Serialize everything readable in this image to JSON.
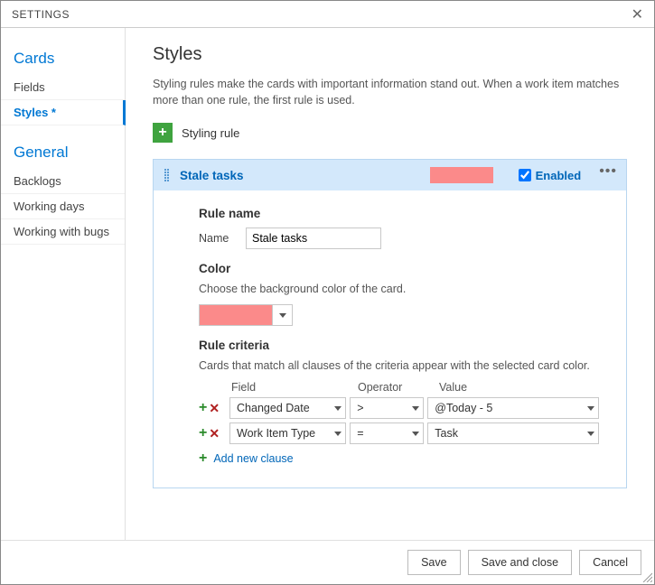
{
  "window": {
    "title": "SETTINGS"
  },
  "sidebar": {
    "sections": [
      {
        "title": "Cards",
        "items": [
          {
            "label": "Fields"
          },
          {
            "label": "Styles *",
            "selected": true
          }
        ]
      },
      {
        "title": "General",
        "items": [
          {
            "label": "Backlogs"
          },
          {
            "label": "Working days"
          },
          {
            "label": "Working with bugs"
          }
        ]
      }
    ]
  },
  "main": {
    "heading": "Styles",
    "description": "Styling rules make the cards with important information stand out. When a work item matches more than one rule, the first rule is used.",
    "add_rule_label": "Styling rule"
  },
  "rule": {
    "header_name": "Stale tasks",
    "enabled_label": "Enabled",
    "enabled": true,
    "swatch_color": "#fb8a8a",
    "sections": {
      "rule_name_title": "Rule name",
      "name_label": "Name",
      "name_value": "Stale tasks",
      "color_title": "Color",
      "color_desc": "Choose the background color of the card.",
      "criteria_title": "Rule criteria",
      "criteria_desc": "Cards that match all clauses of the criteria appear with the selected card color.",
      "col_field": "Field",
      "col_operator": "Operator",
      "col_value": "Value",
      "add_clause": "Add new clause"
    },
    "clauses": [
      {
        "field": "Changed Date",
        "operator": ">",
        "value": "@Today - 5"
      },
      {
        "field": "Work Item Type",
        "operator": "=",
        "value": "Task"
      }
    ]
  },
  "footer": {
    "save": "Save",
    "save_close": "Save and close",
    "cancel": "Cancel"
  }
}
